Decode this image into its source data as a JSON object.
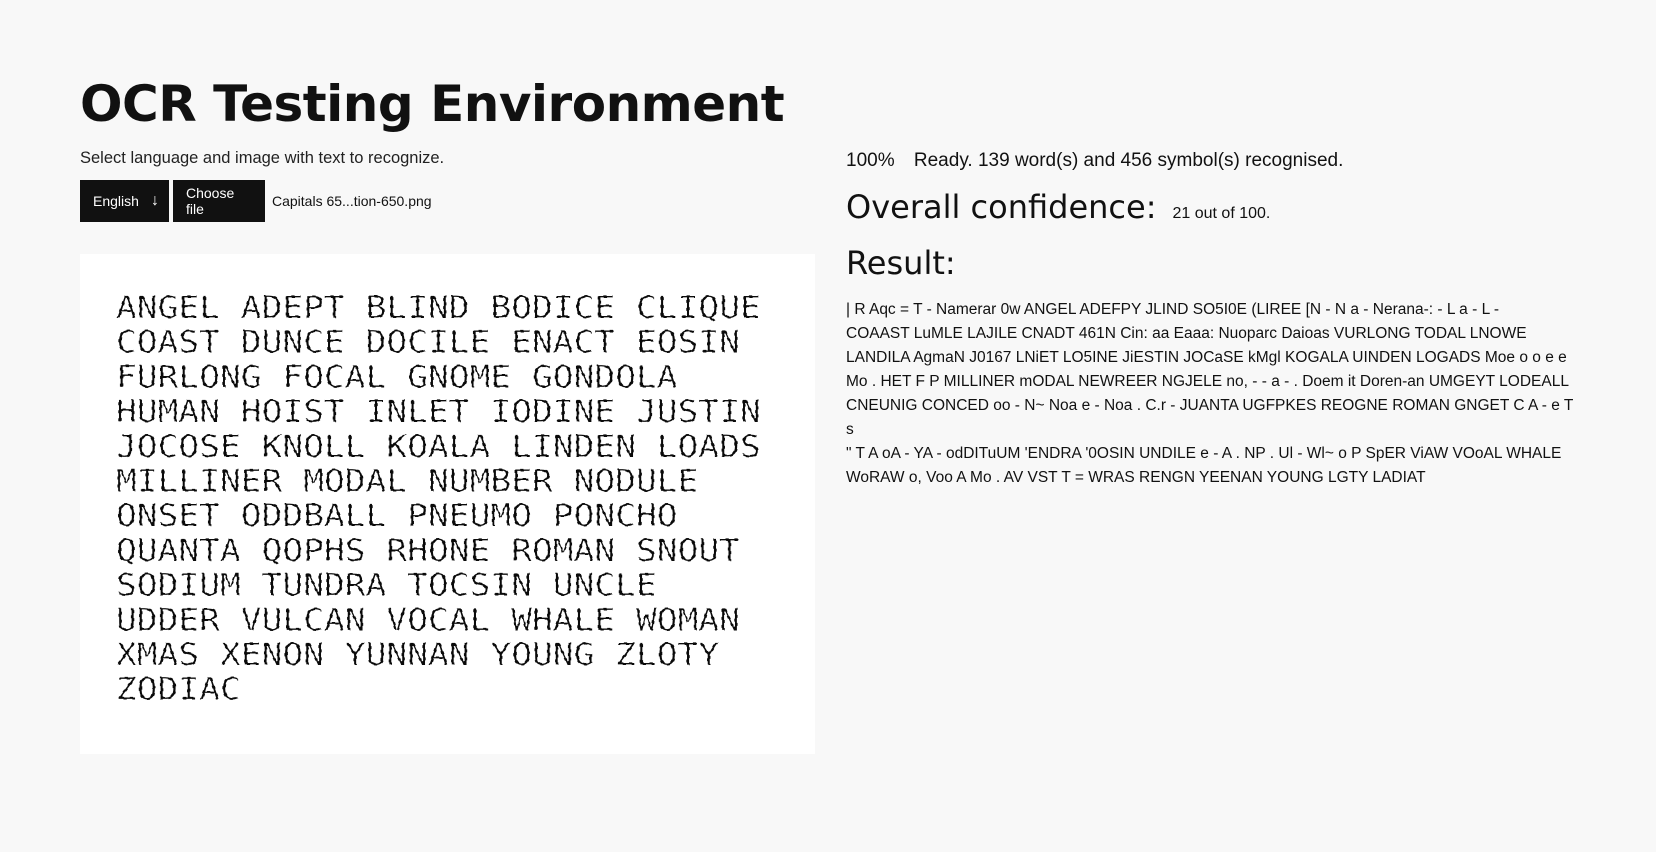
{
  "header": {
    "title": "OCR Testing Environment",
    "subtitle": "Select language and image with text to recognize."
  },
  "controls": {
    "language": "English",
    "language_arrow": "↓",
    "choose_file_label": "Choose file",
    "file_name": "Capitals 65...tion-650.png"
  },
  "preview": {
    "lines": [
      "ANGEL ADEPT BLIND BODICE CLIQUE",
      "COAST DUNCE DOCILE ENACT EOSIN",
      "FURLONG FOCAL GNOME GONDOLA",
      "HUMAN HOIST INLET IODINE JUSTIN",
      "JOCOSE KNOLL KOALA LINDEN LOADS",
      "MILLINER MODAL NUMBER NODULE",
      "ONSET ODDBALL PNEUMO PONCHO",
      "QUANTA QOPHS RHONE ROMAN SNOUT",
      "SODIUM TUNDRA TOCSIN UNCLE",
      "UDDER VULCAN VOCAL WHALE WOMAN",
      "XMAS XENON YUNNAN YOUNG ZLOTY",
      "ZODIAC"
    ]
  },
  "status": {
    "percent": "100%",
    "message": "Ready. 139 word(s) and 456 symbol(s) recognised."
  },
  "confidence": {
    "heading": "Overall confidence:",
    "value": "21 out of 100."
  },
  "result": {
    "heading": "Result:",
    "text": "| R Aqc = T - Namerar 0w ANGEL ADEFPY JLIND SO5I0E (LIREE [N - N a - Nerana-: - L a - L -\nCOAAST LuMLE LAJILE CNADT 461N Cin: aa Eaaa: Nuoparc Daioas VURLONG TODAL LNOWE\nLANDILA AgmaN J0167 LNiET LO5INE JiESTIN JOCaSE kMgl KOGALA UINDEN LOGADS Moe o o e e\nMo . HET F P MILLINER mODAL NEWREER NGJELE no, - - a - . Doem it Doren-an UMGEYT LODEALL\nCNEUNIG CONCED oo - N~ Noa e - Noa . C.r - JUANTA UGFPKES REOGNE ROMAN GNGET C A - e T s\n\" T A oA - YA - odDITuUM 'ENDRA '0OSIN UNDILE e - A . NP . Ul - Wl~ o P SpER ViAW VOoAL WHALE\nWoRAW o, Voo A Mo . AV VST T = WRAS RENGN YEENAN YOUNG LGTY LADIAT"
  }
}
